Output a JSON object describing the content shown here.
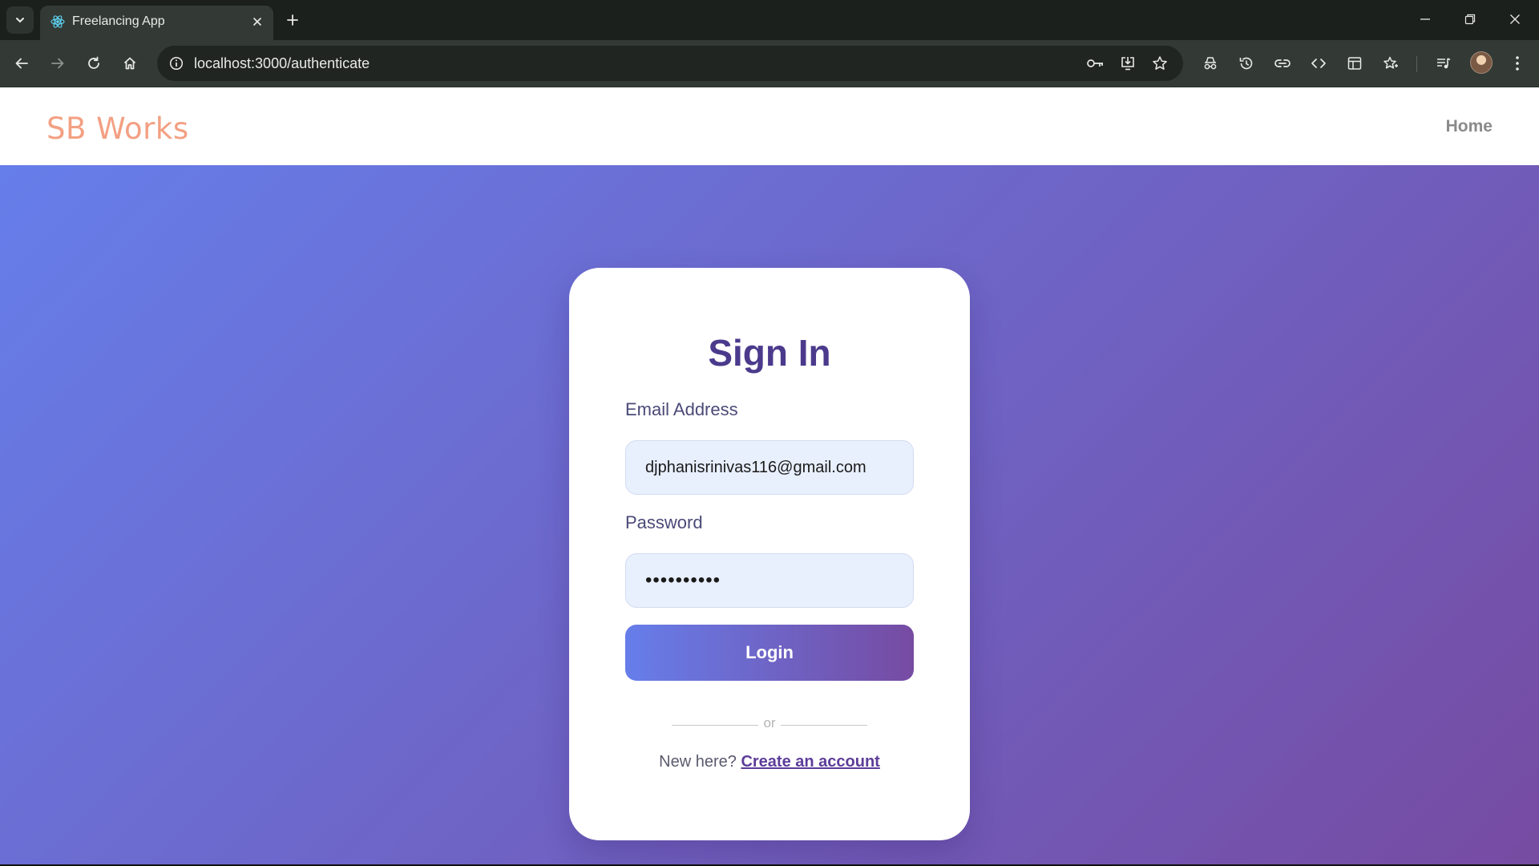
{
  "browser": {
    "tab": {
      "title": "Freelancing App",
      "favicon": "react-logo-icon"
    },
    "address_bar": {
      "url": "localhost:3000/authenticate"
    },
    "icons": {
      "tab_list": "chevron-down-icon",
      "new_tab": "plus-icon",
      "minimize": "minimize-icon",
      "restore": "restore-icon",
      "close": "close-icon",
      "back": "arrow-left-icon",
      "forward": "arrow-right-icon",
      "reload": "reload-icon",
      "home": "home-icon",
      "site_info": "info-icon",
      "passwords": "key-icon",
      "install": "install-app-icon",
      "bookmark": "star-icon",
      "incognito": "incognito-icon",
      "history": "history-icon",
      "link": "link-icon",
      "devtools": "code-icon",
      "side_panel": "side-panel-icon",
      "favorites": "favorites-icon",
      "media": "media-controls-icon",
      "profile": "avatar"
    }
  },
  "navbar": {
    "brand": "SB Works",
    "links": [
      {
        "label": "Home"
      }
    ]
  },
  "form": {
    "title": "Sign In",
    "email": {
      "label": "Email Address",
      "value": "djphanisrinivas116@gmail.com"
    },
    "password": {
      "label": "Password",
      "value": "••••••••••"
    },
    "submit_label": "Login",
    "divider_text": "or",
    "signup_prompt": "New here?",
    "signup_link": "Create an account"
  },
  "colors": {
    "brand": "#f3a083",
    "gradient_start": "#667eea",
    "gradient_end": "#764ba2",
    "title": "#4b3a8c",
    "link": "#5d3d9a",
    "input_bg": "#e8effd"
  }
}
